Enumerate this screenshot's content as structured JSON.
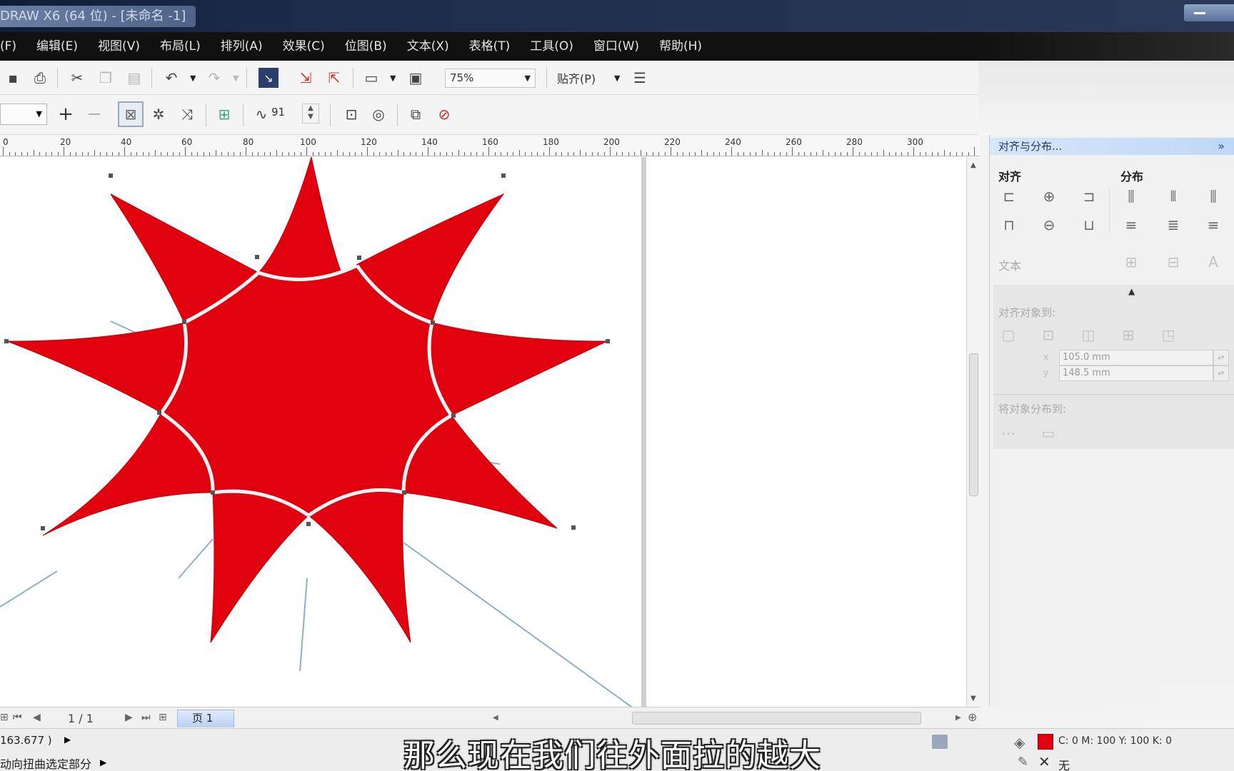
{
  "window": {
    "title": "DRAW X6 (64 位) - [未命名 -1]"
  },
  "menu": {
    "items": [
      "(F)",
      "编辑(E)",
      "视图(V)",
      "布局(L)",
      "排列(A)",
      "效果(C)",
      "位图(B)",
      "文本(X)",
      "表格(T)",
      "工具(O)",
      "窗口(W)",
      "帮助(H)"
    ]
  },
  "toolbar": {
    "zoom": "75%",
    "snap_label": "贴齐(P)",
    "smooth_value": "91"
  },
  "ruler": {
    "labels": [
      "0",
      "20",
      "40",
      "60",
      "80",
      "100",
      "120",
      "140",
      "160",
      "180",
      "200",
      "220",
      "240",
      "260",
      "280",
      "300"
    ]
  },
  "docker": {
    "title": "对齐与分布...",
    "align_label": "对齐",
    "distribute_label": "分布",
    "text_label": "文本",
    "align_to_label": "对齐对象到:",
    "x_value": "105.0 mm",
    "y_value": "148.5 mm",
    "distribute_to_label": "将对象分布到:"
  },
  "page_nav": {
    "count": "1 / 1",
    "tab_label": "页 1"
  },
  "status": {
    "coordinates": "163.677 )",
    "hint": "动向扭曲选定部分",
    "fill_text": "C: 0 M: 100 Y: 100 K: 0",
    "outline_text": "无"
  },
  "subtitle": "那么现在我们往外面拉的越大",
  "colors": {
    "fill": "#e0000e",
    "menubar": "#111111",
    "docker_header": "#c9ddf7"
  },
  "icons": [
    "save-icon",
    "print-icon",
    "cut-icon",
    "copy-icon",
    "paste-icon",
    "undo-icon",
    "redo-icon",
    "import-icon",
    "export-icon",
    "publish-icon",
    "zoom-tool-icon"
  ]
}
